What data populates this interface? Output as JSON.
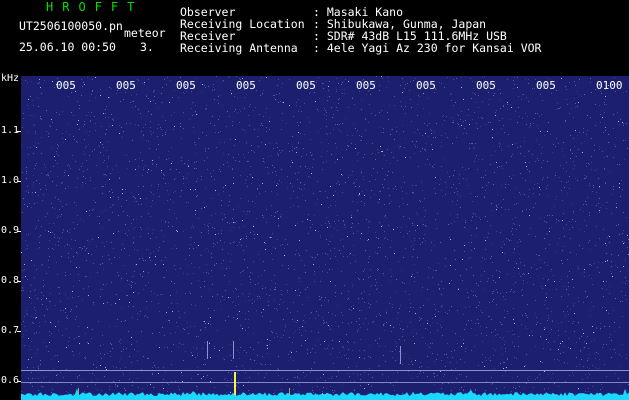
{
  "header": {
    "app_title": "HROFFT",
    "file_name": "UT2506100050.pn",
    "event_type": "meteor",
    "date_time": "25.06.10 00:50",
    "count_value": "3.",
    "meta": [
      {
        "label": "Observer",
        "value": ": Masaki Kano"
      },
      {
        "label": "Receiving Location",
        "value": ": Shibukawa, Gunma, Japan"
      },
      {
        "label": "Receiver",
        "value": ": SDR# 43dB L15 111.6MHz USB"
      },
      {
        "label": "Receiving Antenna",
        "value": ": 4ele Yagi Az 230 for Kansai VOR"
      }
    ]
  },
  "spectrogram": {
    "frequency_unit": "kHz",
    "time_ticks": [
      "005",
      "005",
      "005",
      "005",
      "005",
      "005",
      "005",
      "005",
      "005",
      "0100"
    ],
    "frequency_ticks": [
      "1.1",
      "1.0",
      "0.9",
      "0.8",
      "0.7",
      "0.6"
    ],
    "colors": {
      "background": "#1b1f6e",
      "noise": "#6a72d8",
      "reference_line": "#a9b0e6",
      "trace": "#1ad8ff",
      "meteor": "#ffff40"
    }
  }
}
